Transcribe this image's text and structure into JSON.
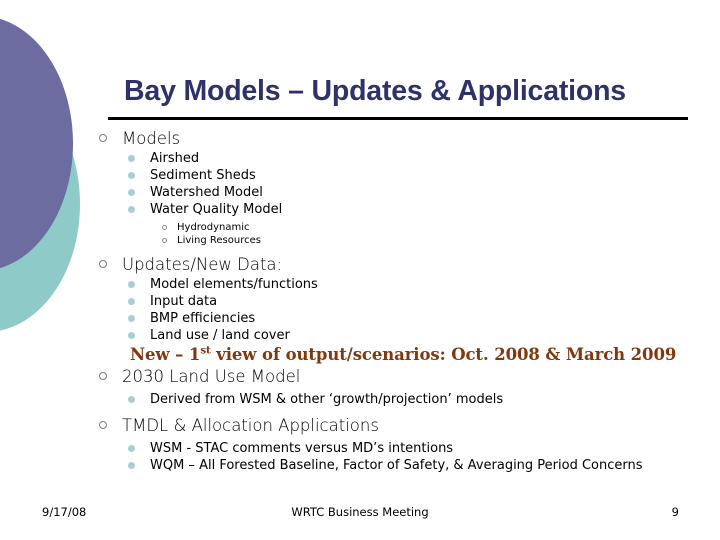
{
  "slide": {
    "title": "Bay Models – Updates & Applications",
    "theme": {
      "title_color": "#2F3269",
      "accent_purple": "#6C6CA0",
      "accent_teal": "#8ECAC8",
      "bullet_teal": "#A9D0CF",
      "highlight_brown": "#80380F",
      "rule_color": "#000000",
      "body_color": "#000000"
    },
    "sections": [
      {
        "heading": "Models",
        "items": [
          {
            "label": "Airshed",
            "subitems": []
          },
          {
            "label": "Sediment Sheds",
            "subitems": []
          },
          {
            "label": "Watershed Model",
            "subitems": []
          },
          {
            "label": "Water Quality Model",
            "subitems": [
              "Hydrodynamic",
              "Living Resources"
            ]
          }
        ]
      },
      {
        "heading": "Updates/New Data:",
        "items": [
          {
            "label": "Model elements/functions",
            "subitems": []
          },
          {
            "label": "Input data",
            "subitems": []
          },
          {
            "label": "BMP efficiencies",
            "subitems": []
          },
          {
            "label": "Land use / land cover",
            "subitems": []
          }
        ],
        "highlight": {
          "prefix": "New – 1",
          "superscript": "st",
          "suffix": " view of output/scenarios: Oct. 2008 & March 2009"
        }
      },
      {
        "heading": "2030 Land Use Model",
        "items": [
          {
            "label": "Derived from WSM & other ‘growth/projection’ models",
            "subitems": []
          }
        ]
      },
      {
        "heading": "TMDL & Allocation Applications",
        "items": [
          {
            "label": "WSM - STAC comments versus MD’s intentions",
            "subitems": []
          },
          {
            "label": "WQM – All Forested Baseline, Factor of Safety, & Averaging Period Concerns",
            "subitems": []
          }
        ]
      }
    ]
  },
  "footer": {
    "date": "9/17/08",
    "center": "WRTC  Business Meeting",
    "page_number": "9"
  }
}
